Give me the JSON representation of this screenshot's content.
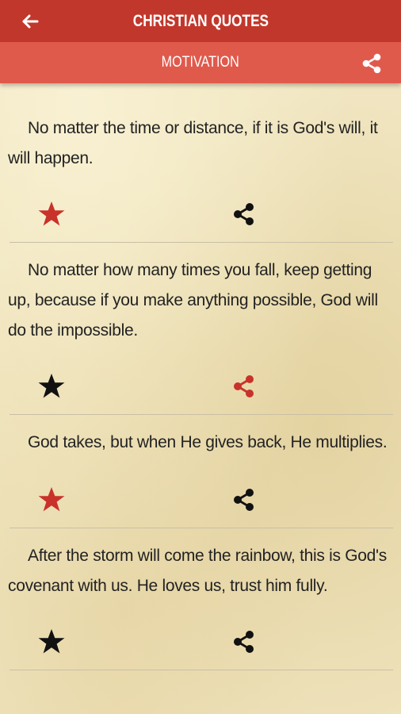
{
  "header": {
    "title": "CHRISTIAN QUOTES",
    "back_icon": "arrow-left-icon",
    "bg_color": "#c2372c"
  },
  "subheader": {
    "category": "MOTIVATION",
    "share_icon": "share-icon",
    "bg_color": "#e05a4c"
  },
  "accent_color": "#c8322a",
  "quotes": [
    {
      "text": "No matter the time or distance, if it is God's will, it will happen.",
      "favorited": true,
      "share_highlighted": false
    },
    {
      "text": "No matter how many times you fall, keep getting up, because if you make anything possible, God will do the impossible.",
      "favorited": false,
      "share_highlighted": true
    },
    {
      "text": "God takes, but when He gives back, He multiplies.",
      "favorited": true,
      "share_highlighted": false
    },
    {
      "text": "After the storm will come the rainbow, this is God's covenant with us. He loves us, trust him fully.",
      "favorited": false,
      "share_highlighted": false
    }
  ]
}
